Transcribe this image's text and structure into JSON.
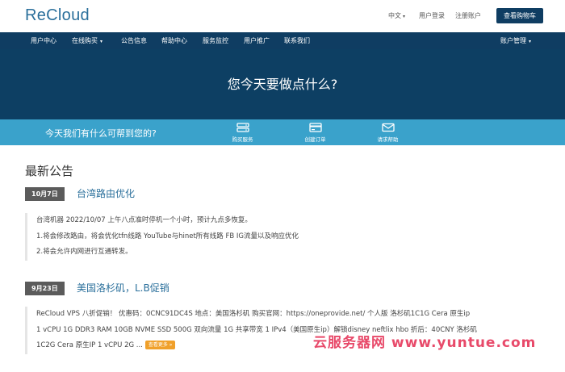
{
  "header": {
    "logo": "ReCloud",
    "language": "中文",
    "login": "用户登录",
    "register": "注册账户",
    "cart_button": "查看购物车"
  },
  "nav": {
    "items": [
      {
        "label": "用户中心"
      },
      {
        "label": "在线购买",
        "dropdown": true
      },
      {
        "label": "公告信息"
      },
      {
        "label": "帮助中心"
      },
      {
        "label": "服务监控"
      },
      {
        "label": "用户推广"
      },
      {
        "label": "联系我们"
      }
    ],
    "account": "账户管理"
  },
  "hero": {
    "title": "您今天要做点什么?"
  },
  "helpbar": {
    "text": "今天我们有什么可帮到您的?",
    "tiles": [
      {
        "label": "购买服务",
        "icon": "server-icon"
      },
      {
        "label": "创建订单",
        "icon": "credit-card-icon"
      },
      {
        "label": "请求帮助",
        "icon": "envelope-icon"
      }
    ]
  },
  "announcements": {
    "title": "最新公告",
    "items": [
      {
        "date": "10月7日",
        "title": "台湾路由优化",
        "lines": [
          "台湾机器 2022/10/07 上午八点准时停机一个小时，预计九点多恢复。",
          "1.将会修改路由，将会优化tfn线路 YouTube与hinet所有线路 FB IG流量以及响应优化",
          "2.将会允许内网进行互通转发。"
        ]
      },
      {
        "date": "9月23日",
        "title": "美国洛杉矶，L.B促销",
        "lines": [
          "ReCloud VPS 八折促销！ 优惠码：0CNC91DC4S 地点：美国洛杉矶 购买官网：https://oneprovide.net/   个人版 洛杉矶1C1G Cera 原生ip",
          "1 vCPU 1G DDR3 RAM 10GB NVME SSD 500G 双向流量 1G 共享带宽 1 IPv4（美国原生ip）解锁disney neftlix hbo 折后：40CNY    洛杉矶",
          "1C2G Cera 原生IP 1 vCPU 2G ..."
        ],
        "more": "查看更多 »"
      }
    ]
  },
  "watermark": "云服务器网 www.yuntue.com"
}
